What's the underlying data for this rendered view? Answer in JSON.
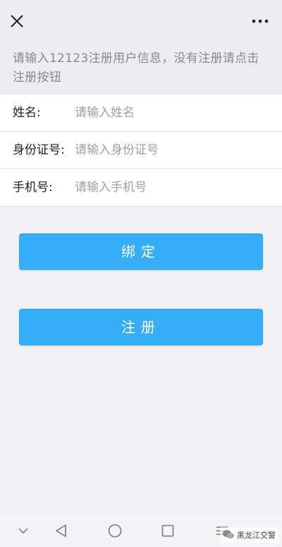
{
  "notice": {
    "text": "请输入12123注册用户信息，没有注册请点击注册按钮"
  },
  "form": {
    "name_label": "姓名:",
    "name_placeholder": "请输入姓名",
    "id_label": "身份证号:",
    "id_placeholder": "请输入身份证号",
    "phone_label": "手机号:",
    "phone_placeholder": "请输入手机号"
  },
  "buttons": {
    "bind_label": "绑定",
    "register_label": "注册"
  },
  "topbar": {
    "close_icon": "close-icon",
    "more_icon": "more-dots-icon"
  },
  "navbar": {
    "icons": [
      "chevron-down-icon",
      "back-triangle-icon",
      "home-circle-icon",
      "recent-square-icon",
      "menu-lines-icon"
    ]
  },
  "watermark": {
    "text": "黑龙江交警"
  },
  "colors": {
    "accent": "#35aef7",
    "background": "#f2f2f4",
    "notice_text": "#8a8a8a"
  }
}
